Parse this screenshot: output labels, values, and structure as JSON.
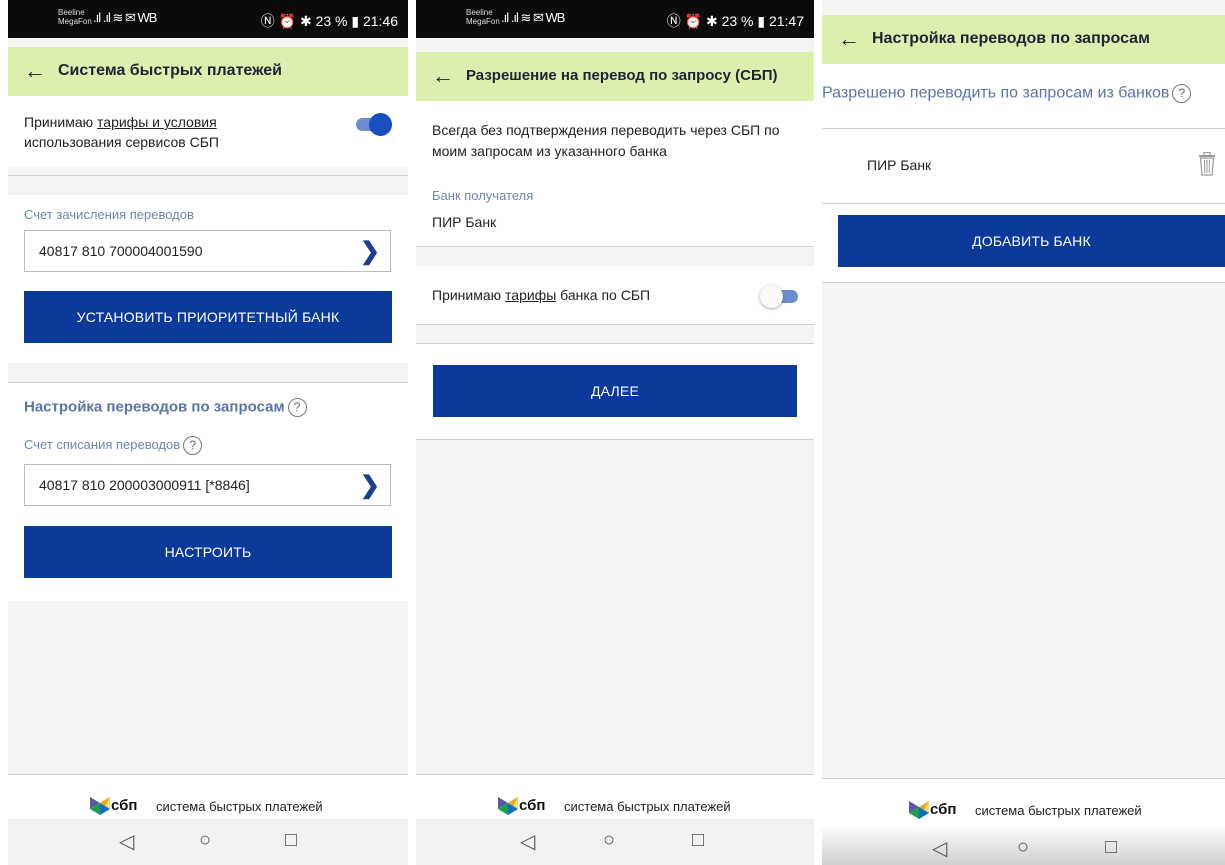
{
  "status_bar": {
    "carrier_top": "Beeline",
    "carrier_bottom": "MegaFon",
    "signal": ".ıl .ıl ≋ ✉ WB",
    "right_1": "Ⓝ ⏰ ✱ 23 % ▮ 21:46",
    "right_2": "Ⓝ ⏰ ✱ 23 % ▮ 21:47"
  },
  "screen1": {
    "title": "Система быстрых платежей",
    "accept_prefix": "Принимаю ",
    "accept_link": "тарифы и условия",
    "accept_line2": "использования сервисов СБП",
    "accept_toggle_on": true,
    "credit_label": "Счет зачисления переводов",
    "credit_account": "40817 810 700004001590",
    "priority_button": "УСТАНОВИТЬ ПРИОРИТЕТНЫЙ БАНК",
    "request_heading": "Настройка переводов по запросам",
    "debit_label": "Счет списания переводов",
    "debit_account": "40817 810 200003000911 [*8846]",
    "configure_button": "НАСТРОИТЬ"
  },
  "screen2": {
    "title": "Разрешение на перевод по запросу (СБП)",
    "description_line1": "Всегда без подтверждения переводить через СБП по",
    "description_line2": "моим запросам из указанного банка",
    "recipient_bank_label": "Банк получателя",
    "recipient_bank": "ПИР Банк",
    "accept_prefix": "Принимаю ",
    "accept_link": "тарифы",
    "accept_suffix": " банка по СБП",
    "accept_toggle_on": false,
    "next_button": "ДАЛЕЕ"
  },
  "screen3": {
    "title": "Настройка переводов по запросам",
    "allowed_heading": "Разрешено переводить по запросам из банков",
    "bank_name": "ПИР Банк",
    "add_bank_button": "ДОБАВИТЬ БАНК"
  },
  "footer": {
    "brand": "сбп",
    "brand_text": "система быстрых платежей"
  },
  "help_mark": "?",
  "icons": {
    "back": "←",
    "chevron": "❯",
    "nav_back": "◁",
    "nav_home": "○",
    "nav_recent": "□"
  },
  "colors": {
    "appbar": "#dcefae",
    "primary_button": "#0c3a9b",
    "label_blue": "#6d86b3",
    "toggle_on": "#1a4fbf"
  }
}
